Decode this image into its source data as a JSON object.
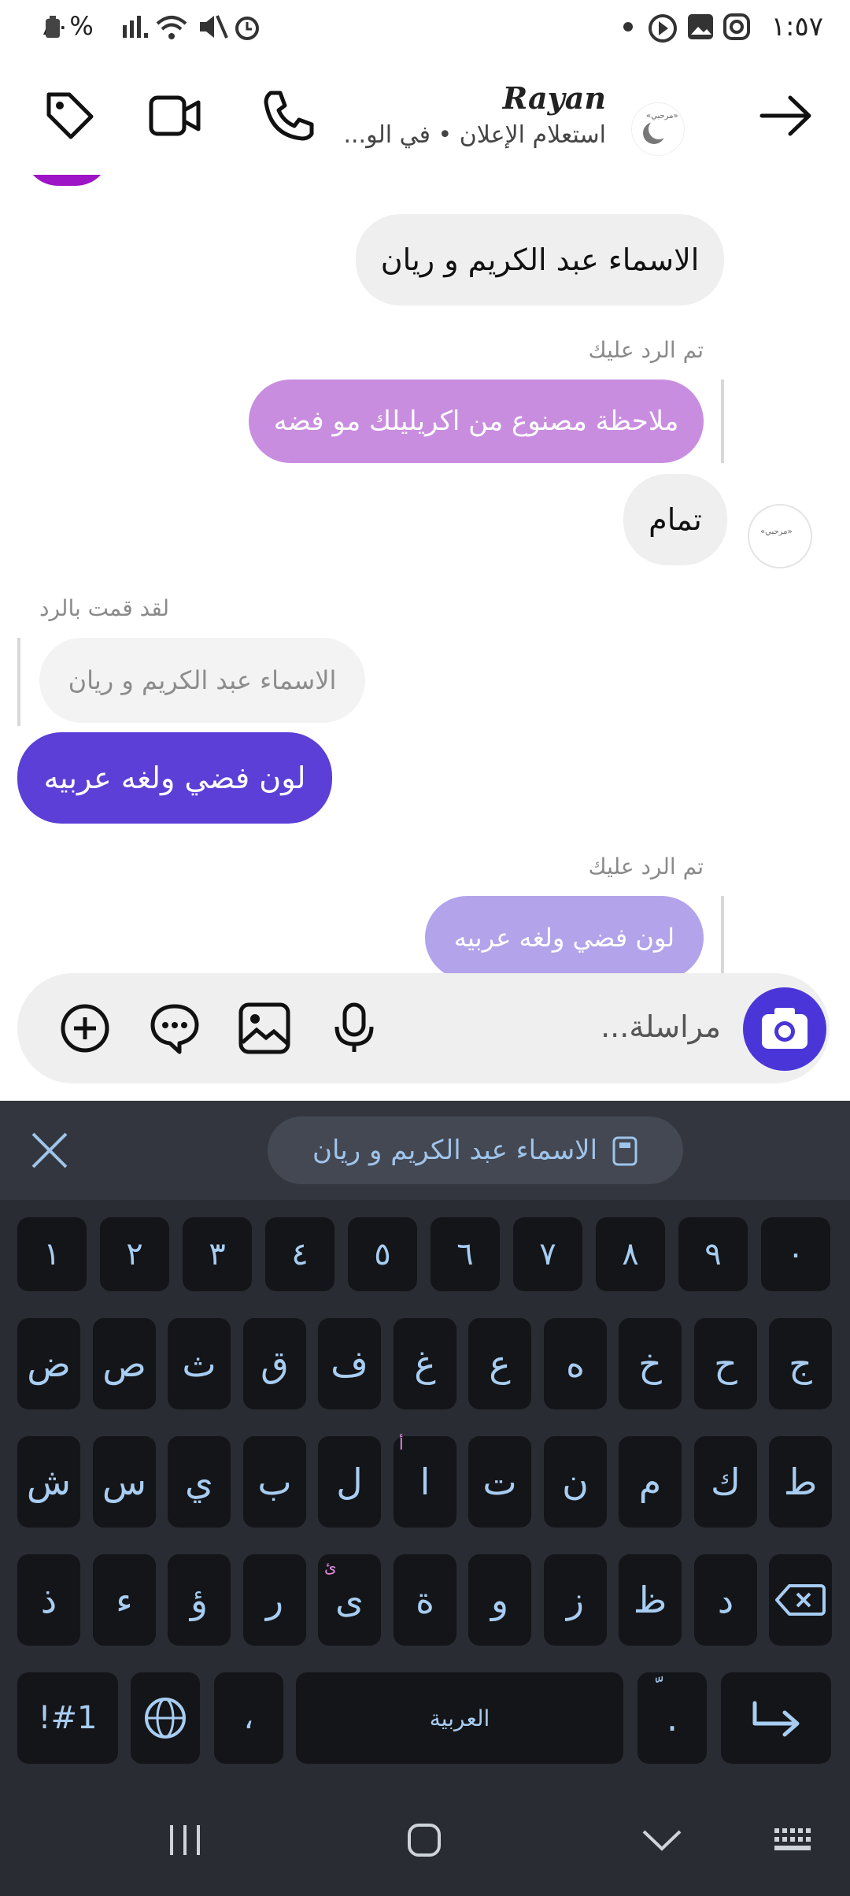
{
  "status_bar": {
    "time": "١:٥٧",
    "battery": "٨٠%"
  },
  "header": {
    "title": "Rayan",
    "subtitle": "استعلام الإعلان • في الو...",
    "avatar_text": "«مرحبي»"
  },
  "messages": {
    "m1": "الاسماء عبد الكريم و ريان",
    "m2_meta": "تم الرد عليك",
    "m2": "ملاحظة مصنوع من اكريليلك مو فضه",
    "m3": "تمام",
    "m4_meta": "لقد قمت بالرد",
    "m4_quote": "الاسماء عبد الكريم و ريان",
    "m4": "لون فضي ولغه عربيه",
    "m5_meta": "تم الرد عليك",
    "m5": "لون فضي ولغه عربيه"
  },
  "composer": {
    "placeholder": "مراسلة..."
  },
  "keyboard": {
    "clipboard_text": "الاسماء عبد الكريم و ريان",
    "row_numbers": [
      "١",
      "٢",
      "٣",
      "٤",
      "٥",
      "٦",
      "٧",
      "٨",
      "٩",
      "٠"
    ],
    "row1": [
      "ض",
      "ص",
      "ث",
      "ق",
      "ف",
      "غ",
      "ع",
      "ه",
      "خ",
      "ح",
      "ج"
    ],
    "row2": [
      "ش",
      "س",
      "ي",
      "ب",
      "ل",
      "ا",
      "ت",
      "ن",
      "م",
      "ك",
      "ط"
    ],
    "row3": [
      "ذ",
      "ء",
      "ؤ",
      "ر",
      "ى",
      "ة",
      "و",
      "ز",
      "ظ",
      "د"
    ],
    "hint_alef": "أ",
    "hint_ya": "ئ",
    "sym_key": "!#1",
    "comma_key": "،",
    "space_label": "العربية",
    "period_key": ".",
    "period_hint": "ّ"
  },
  "colors": {
    "accent_purple": "#5b3fd6",
    "bubble_pink": "#c98de0",
    "bubble_lavender": "#b3a3ea",
    "bubble_gray": "#efefef"
  }
}
